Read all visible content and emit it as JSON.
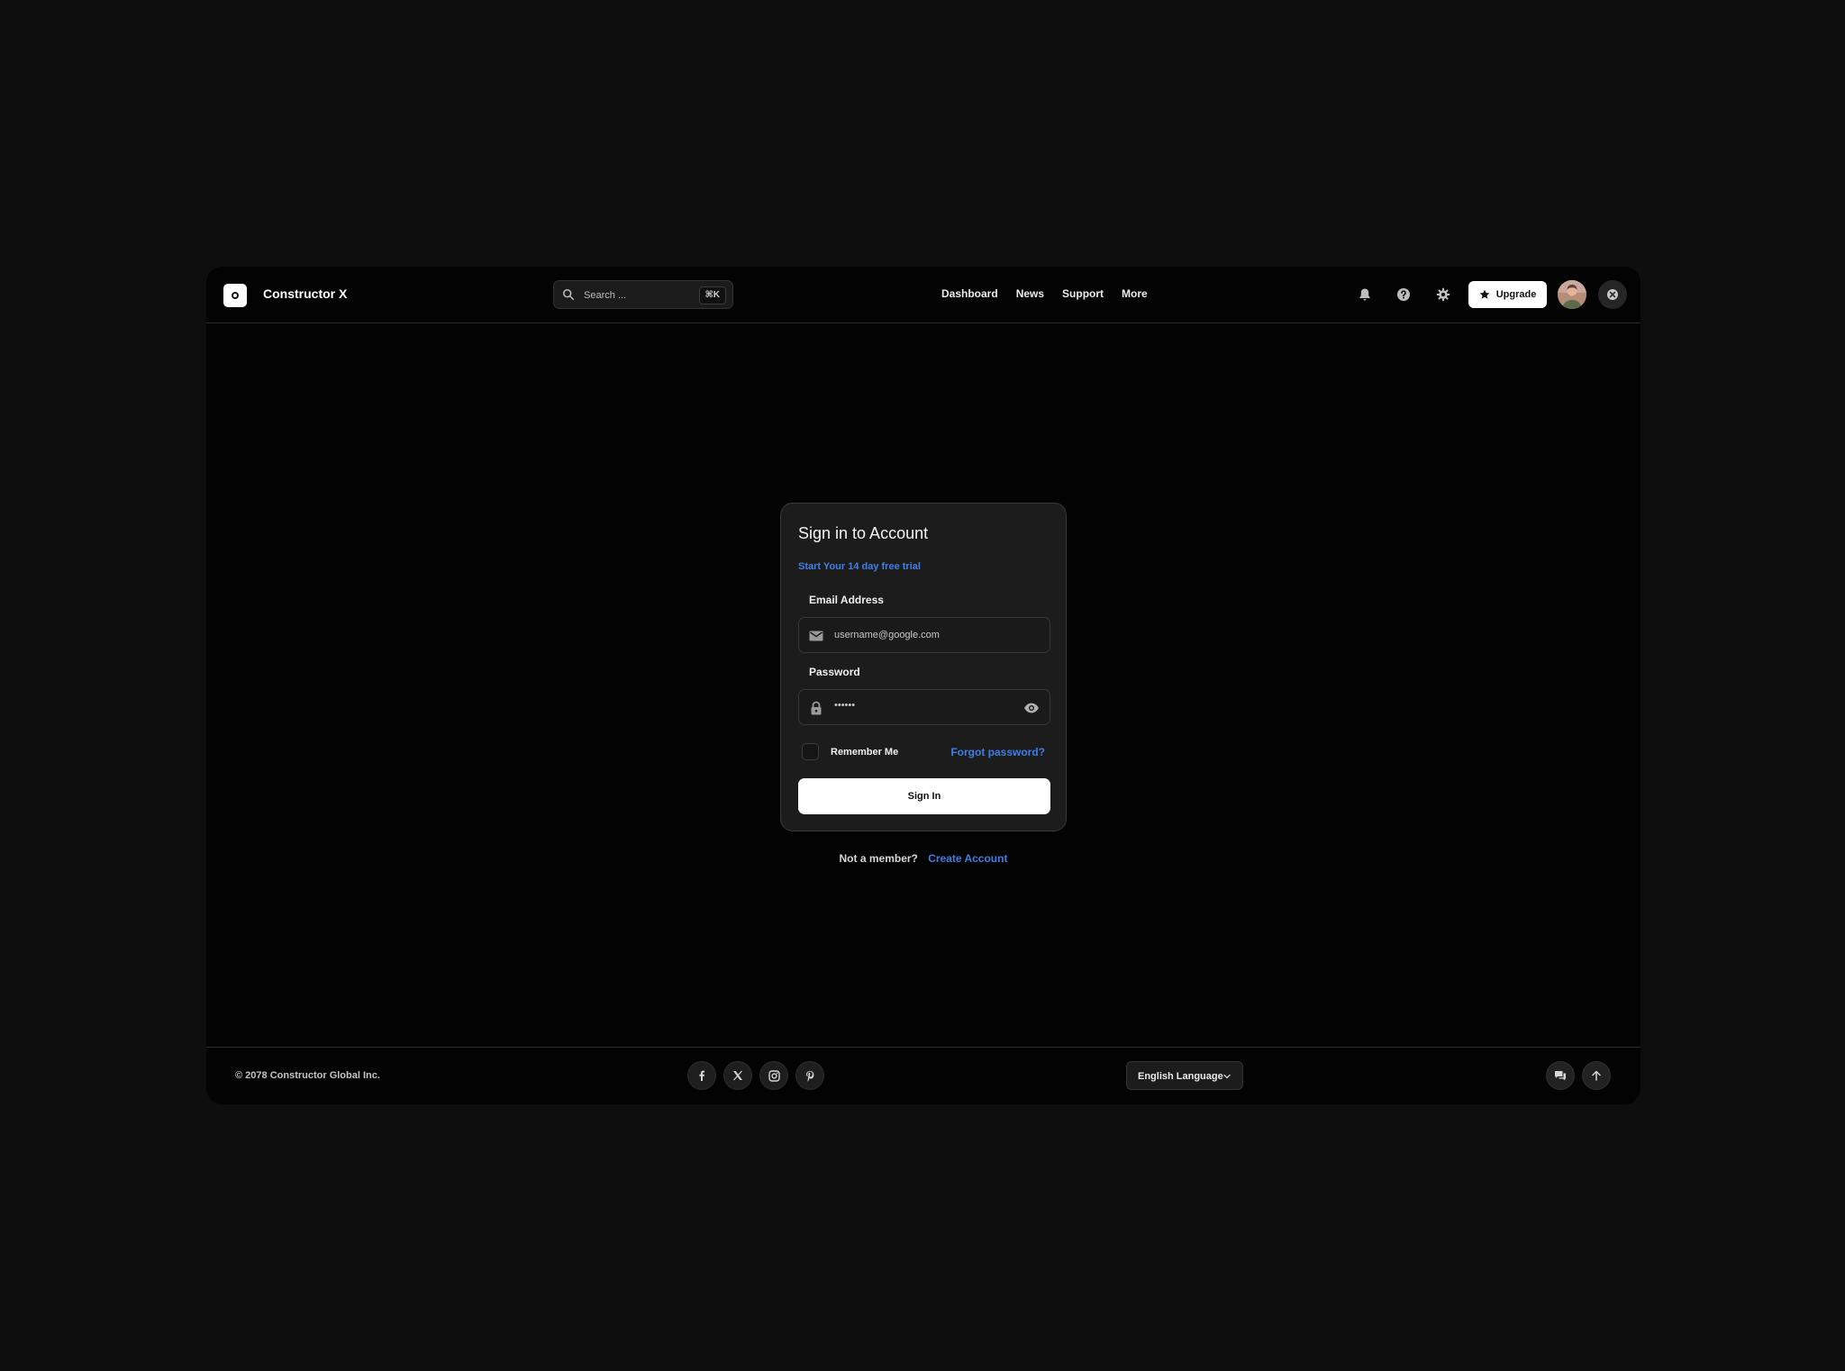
{
  "header": {
    "brand": "Constructor X",
    "search": {
      "placeholder": "Search ...",
      "shortcut": "⌘K"
    },
    "nav": [
      "Dashboard",
      "News",
      "Support",
      "More"
    ],
    "upgrade_label": "Upgrade"
  },
  "login": {
    "title": "Sign in to Account",
    "trial_link": "Start Your 14 day free trial",
    "email_label": "Email Address",
    "email_value": "username@google.com",
    "password_label": "Password",
    "password_value": "••••••",
    "remember_label": "Remember Me",
    "forgot_label": "Forgot password?",
    "submit_label": "Sign In",
    "not_member": "Not a member?",
    "create_account": "Create Account"
  },
  "footer": {
    "copyright": "© 2078 Constructor Global Inc.",
    "social": [
      "facebook-icon",
      "x-icon",
      "instagram-icon",
      "pinterest-icon"
    ],
    "language": "English Language"
  },
  "colors": {
    "accent": "#3f7fe6",
    "background": "#030303",
    "card": "#1c1c1c"
  }
}
